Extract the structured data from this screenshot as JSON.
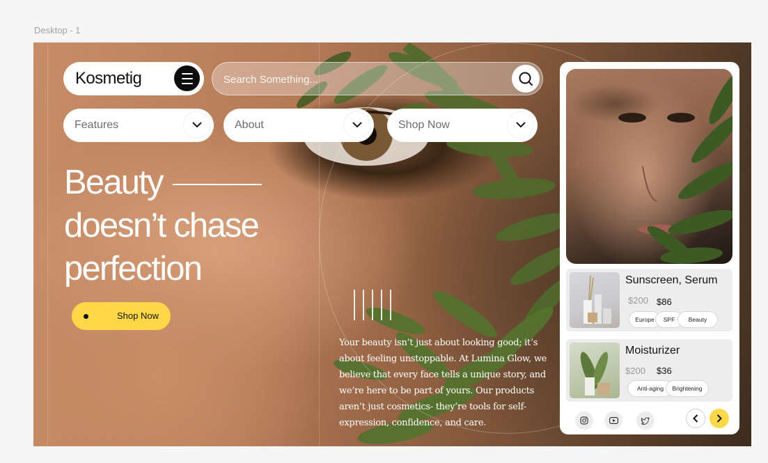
{
  "frame_label": "Desktop - 1",
  "brand": {
    "logo": "Kosmetig"
  },
  "search": {
    "placeholder": "Search Something..."
  },
  "nav": [
    {
      "label": "Features"
    },
    {
      "label": "About"
    },
    {
      "label": "Shop Now"
    }
  ],
  "hero": {
    "line1": "Beauty",
    "line2": "doesn’t chase",
    "line3": "perfection"
  },
  "cta": {
    "label": "Shop Now"
  },
  "description": "Your beauty isn’t just about looking good; it’s about feeling unstoppable. At Lumina Glow, we believe that every face tells a unique story, and we’re here to be part of yours. Our products aren’t just cosmetics- they’re tools for self-expression, confidence, and care.",
  "products": [
    {
      "name": "Sunscreen, Serum",
      "old_price": "$200",
      "new_price": "$86",
      "tags": [
        "Europe",
        "SPF",
        "Beauty"
      ]
    },
    {
      "name": "Moisturizer",
      "old_price": "$200",
      "new_price": "$36",
      "tags": [
        "Anti-aging",
        "Brightening"
      ]
    }
  ],
  "social": [
    "instagram-icon",
    "youtube-icon",
    "twitter-icon"
  ],
  "colors": {
    "accent": "#ffd84a",
    "dark": "#0d0d0d",
    "card": "#ffffff"
  }
}
